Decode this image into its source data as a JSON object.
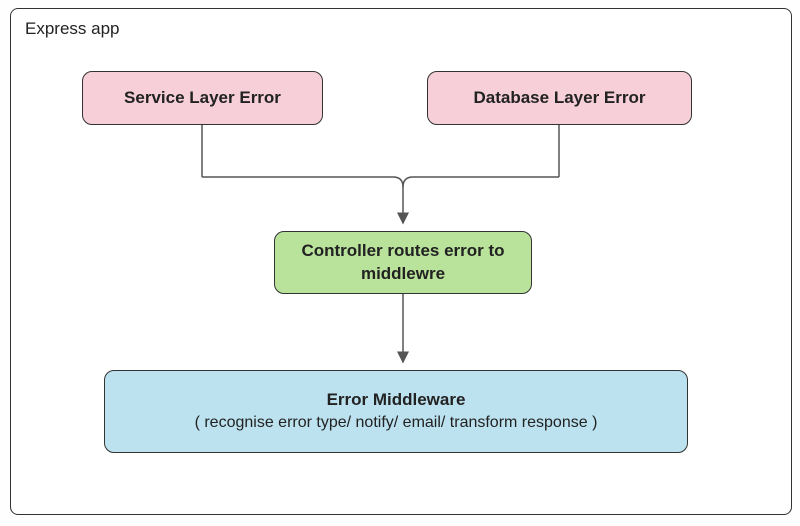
{
  "container": {
    "title": "Express app"
  },
  "nodes": {
    "service": {
      "label": "Service Layer Error"
    },
    "database": {
      "label": "Database Layer Error"
    },
    "controller": {
      "line1": "Controller routes error to",
      "line2": "middlewre"
    },
    "middleware": {
      "title": "Error Middleware",
      "subtitle": "( recognise error type/ notify/ email/ transform response )"
    }
  },
  "chart_data": {
    "type": "diagram",
    "title": "Express app",
    "nodes": [
      {
        "id": "service",
        "label": "Service Layer Error",
        "color": "pink"
      },
      {
        "id": "database",
        "label": "Database Layer Error",
        "color": "pink"
      },
      {
        "id": "controller",
        "label": "Controller routes error to middlewre",
        "color": "green"
      },
      {
        "id": "middleware",
        "label": "Error Middleware ( recognise error type/ notify/ email/ transform response )",
        "color": "blue"
      }
    ],
    "edges": [
      {
        "from": "service",
        "to": "controller"
      },
      {
        "from": "database",
        "to": "controller"
      },
      {
        "from": "controller",
        "to": "middleware"
      }
    ]
  }
}
